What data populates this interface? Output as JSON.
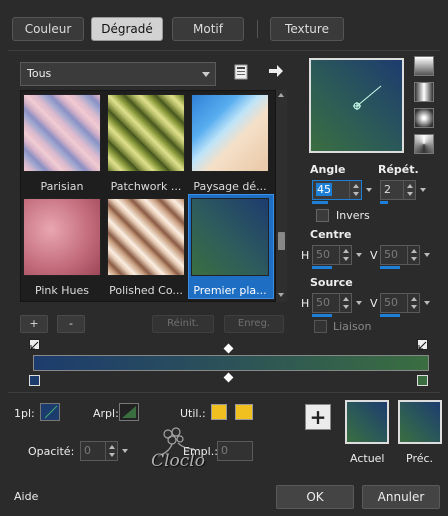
{
  "tabs": [
    {
      "label": "Couleur"
    },
    {
      "label": "Dégradé"
    },
    {
      "label": "Motif"
    },
    {
      "label": "Texture"
    }
  ],
  "library": {
    "category": "Tous"
  },
  "presets": [
    {
      "name": "Parisian"
    },
    {
      "name": "Patchwork ..."
    },
    {
      "name": "Paysage dé..."
    },
    {
      "name": "Pink Hues"
    },
    {
      "name": "Polished Co..."
    },
    {
      "name": "Premier pla..."
    }
  ],
  "preset_buttons": {
    "add": "+",
    "remove": "-",
    "reset": "Réinit.",
    "save": "Enreg."
  },
  "angle": {
    "label": "Angle",
    "value": "45"
  },
  "repeat": {
    "label": "Répét.",
    "value": "2"
  },
  "invert": {
    "label": "Invers"
  },
  "center": {
    "label": "Centre",
    "h_label": "H",
    "h_value": "50",
    "v_label": "V",
    "v_value": "50"
  },
  "source": {
    "label": "Source",
    "h_label": "H",
    "h_value": "50",
    "v_label": "V",
    "v_value": "50"
  },
  "link": {
    "label": "Liaison"
  },
  "bottom": {
    "fg_label": "1pl:",
    "bg_label": "Arpl:",
    "use_label": "Util.:",
    "opacity_label": "Opacité:",
    "opacity_value": "0",
    "location_label": "Empl.:",
    "location_value": "0",
    "current_label": "Actuel",
    "previous_label": "Préc.",
    "add_label": "+"
  },
  "watermark": "Cloclo",
  "footer": {
    "help": "Aide",
    "ok": "OK",
    "cancel": "Annuler"
  },
  "colors": {
    "dark_blue": "#1d3c6e",
    "green": "#3a6e40",
    "accent": "#1e7fd6",
    "yellow": "#f0c020"
  }
}
